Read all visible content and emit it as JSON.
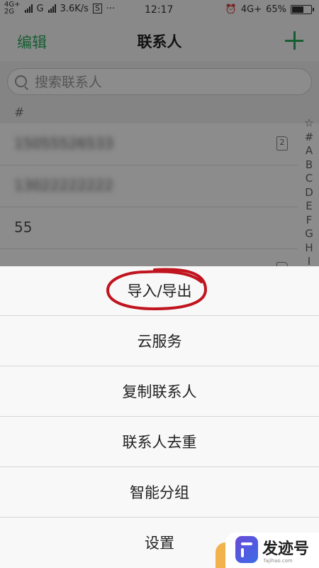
{
  "status_bar": {
    "net1": "4G+",
    "net2": "2G",
    "carrier2": "G",
    "speed": "3.6K/s",
    "dots": "···",
    "time": "12:17",
    "net_right": "4G+",
    "battery": "65%",
    "battery_level": 0.65
  },
  "header": {
    "edit": "编辑",
    "title": "联系人",
    "add_icon": "plus-icon"
  },
  "search": {
    "placeholder": "搜索联系人"
  },
  "list": {
    "section": "#",
    "rows": [
      {
        "name": "15055526533",
        "sim": "2"
      },
      {
        "name": "13022222222",
        "sim": ""
      },
      {
        "name": "55",
        "sim": ""
      }
    ],
    "index": [
      "☆",
      "#",
      "A",
      "B",
      "C",
      "D",
      "E",
      "F",
      "G",
      "H",
      "I"
    ]
  },
  "menu": {
    "items": [
      "导入/导出",
      "云服务",
      "复制联系人",
      "联系人去重",
      "智能分组",
      "设置"
    ],
    "highlight_color": "#c0141e"
  },
  "watermark": {
    "name": "发迹号",
    "url": "fajihao.com"
  }
}
